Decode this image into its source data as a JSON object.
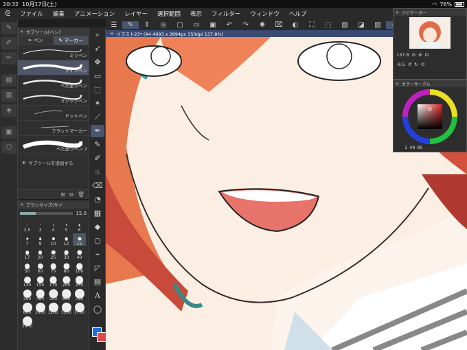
{
  "status": {
    "time": "20:32",
    "date": "10月17日(土)",
    "battery": "76%"
  },
  "menu": [
    "ファイル",
    "編集",
    "アニメーション",
    "レイヤー",
    "選択範囲",
    "表示",
    "フィルター",
    "ウィンドウ",
    "ヘルプ"
  ],
  "subtool": {
    "title": "サブツール[ペン]",
    "tabs": [
      "ペン",
      "マーカー"
    ],
    "brushes": [
      "ミリペン",
      "サインペン",
      "べた塗りペン",
      "マジックペン",
      "ドットペン",
      "フラットマーカー",
      "べた塗りペン 2"
    ],
    "add_label": "サブツールを追加する"
  },
  "brushsize": {
    "title": "ブラシサイズ(サイ",
    "value": "15.0",
    "sizes": [
      "2.5",
      "3",
      "4",
      "5",
      "6",
      "7",
      "8",
      "10",
      "12",
      "15",
      "17",
      "20",
      "25",
      "30",
      "40",
      "50",
      "60",
      "70",
      "80",
      "100",
      "120",
      "150",
      "170",
      "200",
      "250",
      "300",
      "400",
      "500",
      "600",
      "700",
      "800",
      "1000",
      "1200",
      "1500",
      "1700",
      "2000"
    ]
  },
  "document": {
    "title": "イラスト23* (A4 4093 x 2894px 350dpi 137.8%)"
  },
  "navigator": {
    "title": "ナビゲーター",
    "zoom": "137.8",
    "rotation": "-9.5"
  },
  "color_wheel": {
    "title": "カラーサークル",
    "h": "1",
    "s": "49",
    "v": "85"
  },
  "colors": {
    "main": "#1f6fe0",
    "sub": "#e04848",
    "selection": "#4f5668"
  }
}
